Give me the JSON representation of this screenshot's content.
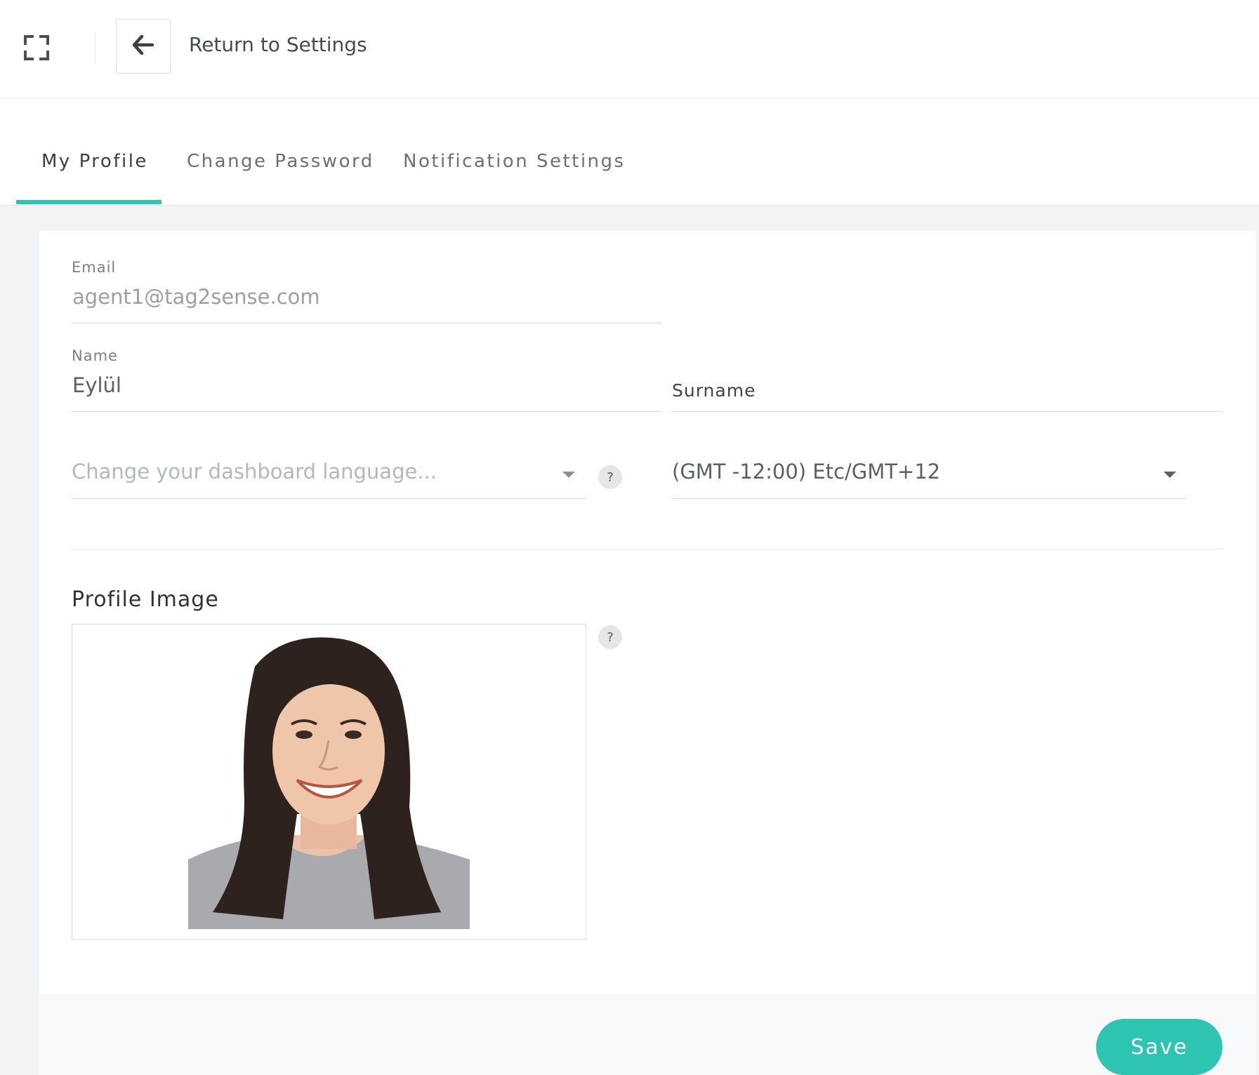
{
  "topbar": {
    "fullscreen_icon": "fullscreen-icon",
    "back_icon": "arrow-left-icon",
    "back_label": "Return to Settings"
  },
  "tabs": [
    {
      "label": "My Profile",
      "active": true
    },
    {
      "label": "Change Password",
      "active": false
    },
    {
      "label": "Notification Settings",
      "active": false
    }
  ],
  "form": {
    "email": {
      "label": "Email",
      "value": "agent1@tag2sense.com"
    },
    "name": {
      "label": "Name",
      "value": "Eylül"
    },
    "surname": {
      "label": "Surname",
      "value": ""
    },
    "language": {
      "placeholder": "Change your dashboard language...",
      "help": "?"
    },
    "timezone": {
      "value": "(GMT -12:00) Etc/GMT+12"
    }
  },
  "profile_image": {
    "title": "Profile Image",
    "help": "?"
  },
  "actions": {
    "save_label": "Save"
  },
  "colors": {
    "accent": "#2ec4b2",
    "page_bg": "#f2f3f5"
  }
}
